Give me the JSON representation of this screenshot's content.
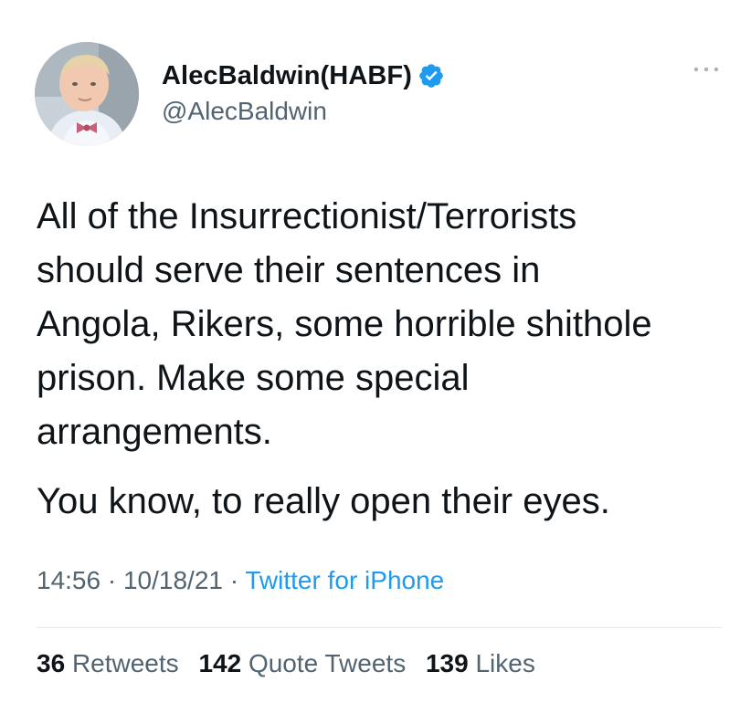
{
  "author": {
    "display_name": "AlecBaldwin(HABF)",
    "handle": "@AlecBaldwin",
    "verified": true,
    "verified_color": "#1d9bf0"
  },
  "tweet": {
    "paragraphs": [
      "All of the Insurrectionist/Terrorists\nshould serve their sentences in\nAngola, Rikers, some horrible shithole\nprison. Make some special\narrangements.",
      "You know, to really open their eyes."
    ],
    "time": "14:56",
    "date": "10/18/21",
    "separator": "·",
    "source": "Twitter for iPhone"
  },
  "stats": {
    "retweets_count": "36",
    "retweets_label": "Retweets",
    "quotes_count": "142",
    "quotes_label": "Quote Tweets",
    "likes_count": "139",
    "likes_label": "Likes"
  },
  "icons": {
    "more": "more-options-icon",
    "verified": "verified-badge-icon"
  }
}
